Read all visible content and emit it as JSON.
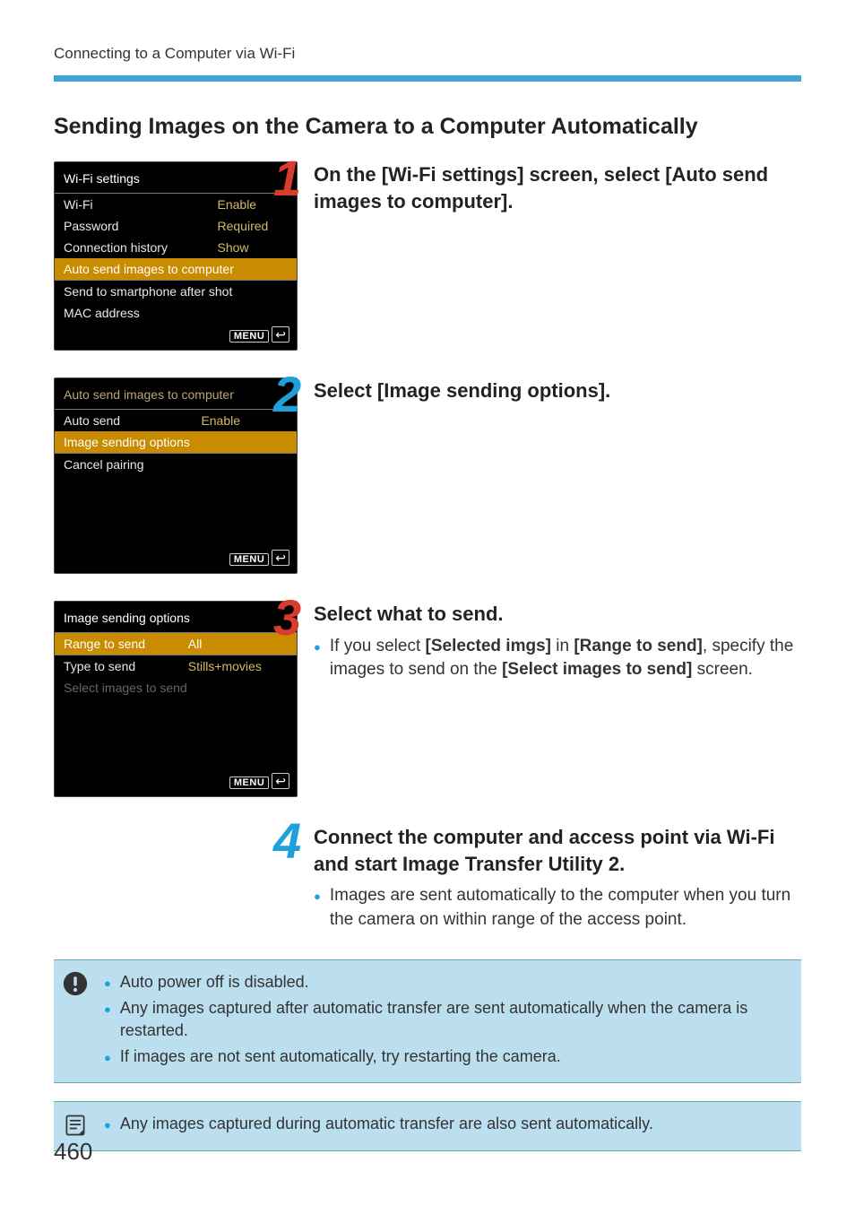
{
  "page": {
    "running_head": "Connecting to a Computer via Wi-Fi",
    "section_title": "Sending Images on the Camera to a Computer Automatically",
    "page_number": "460"
  },
  "lcd1": {
    "title": "Wi-Fi settings",
    "rows": [
      {
        "label": "Wi-Fi",
        "value": "Enable"
      },
      {
        "label": "Password",
        "value": "Required"
      },
      {
        "label": "Connection history",
        "value": "Show"
      },
      {
        "label": "Auto send images to computer",
        "value": ""
      },
      {
        "label": "Send to smartphone after shot",
        "value": ""
      },
      {
        "label": "MAC address",
        "value": ""
      }
    ],
    "menu": "MENU"
  },
  "lcd2": {
    "title": "Auto send images to computer",
    "rows": [
      {
        "label": "Auto send",
        "value": "Enable"
      },
      {
        "label": "Image sending options",
        "value": ""
      },
      {
        "label": "Cancel pairing",
        "value": ""
      }
    ],
    "menu": "MENU"
  },
  "lcd3": {
    "title": "Image sending options",
    "rows": [
      {
        "label": "Range to send",
        "value": "All"
      },
      {
        "label": "Type to send",
        "value": "Stills+movies"
      },
      {
        "label": "Select images to send",
        "value": ""
      }
    ],
    "menu": "MENU"
  },
  "steps": {
    "s1": {
      "num": "1",
      "head": "On the [Wi-Fi settings] screen, select [Auto send images to computer]."
    },
    "s2": {
      "num": "2",
      "head": "Select [Image sending options]."
    },
    "s3": {
      "num": "3",
      "head": "Select what to send.",
      "body_pre": "If you select ",
      "body_b1": "[Selected imgs]",
      "body_mid": " in ",
      "body_b2": "[Range to send]",
      "body_post1": ", specify the images to send on the ",
      "body_b3": "[Select images to send]",
      "body_post2": " screen."
    },
    "s4": {
      "num": "4",
      "head": "Connect the computer and access point via Wi-Fi and start Image Transfer Utility 2.",
      "body": "Images are sent automatically to the computer when you turn the camera on within range of the access point."
    }
  },
  "warn": {
    "b1": "Auto power off is disabled.",
    "b2": "Any images captured after automatic transfer are sent automatically when the camera is restarted.",
    "b3": "If images are not sent automatically, try restarting the camera."
  },
  "note": {
    "b1": "Any images captured during automatic transfer are also sent automatically."
  }
}
